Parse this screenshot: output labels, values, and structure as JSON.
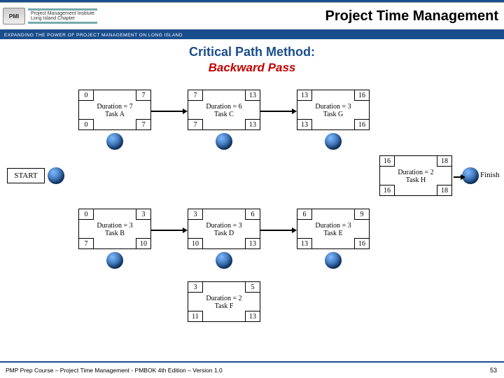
{
  "header": {
    "logo_badge": "PMI",
    "logo_line1": "Project Management Institute",
    "logo_line2": "Long Island Chapter",
    "tagline": "EXPANDING THE POWER OF PROJECT MANAGEMENT ON LONG ISLAND",
    "title": "Project Time Management"
  },
  "subtitle1": "Critical Path Method:",
  "subtitle2": "Backward Pass",
  "labels": {
    "start": "START",
    "finish": "Finish"
  },
  "chart_data": {
    "type": "diagram",
    "method": "CPM backward pass",
    "nodes": [
      {
        "id": "A",
        "name": "Task A",
        "duration": 7,
        "es": 0,
        "ef": 7,
        "ls": 0,
        "lf": 7
      },
      {
        "id": "B",
        "name": "Task B",
        "duration": 3,
        "es": 0,
        "ef": 3,
        "ls": 7,
        "lf": 10
      },
      {
        "id": "C",
        "name": "Task C",
        "duration": 6,
        "es": 7,
        "ef": 13,
        "ls": 7,
        "lf": 13
      },
      {
        "id": "D",
        "name": "Task D",
        "duration": 3,
        "es": 3,
        "ef": 6,
        "ls": 10,
        "lf": 13
      },
      {
        "id": "E",
        "name": "Task E",
        "duration": 3,
        "es": 6,
        "ef": 9,
        "ls": 13,
        "lf": 16
      },
      {
        "id": "F",
        "name": "Task F",
        "duration": 2,
        "es": 3,
        "ef": 5,
        "ls": 11,
        "lf": 13
      },
      {
        "id": "G",
        "name": "Task G",
        "duration": 3,
        "es": 13,
        "ef": 16,
        "ls": 13,
        "lf": 16
      },
      {
        "id": "H",
        "name": "Task H",
        "duration": 2,
        "es": 16,
        "ef": 18,
        "ls": 16,
        "lf": 18
      }
    ],
    "edges": [
      [
        "START",
        "A"
      ],
      [
        "START",
        "B"
      ],
      [
        "A",
        "C"
      ],
      [
        "C",
        "G"
      ],
      [
        "G",
        "H"
      ],
      [
        "H",
        "Finish"
      ],
      [
        "B",
        "D"
      ],
      [
        "D",
        "E"
      ],
      [
        "B",
        "F"
      ],
      [
        "D",
        "G"
      ],
      [
        "E",
        "H"
      ],
      [
        "F",
        "E"
      ]
    ]
  },
  "footer": "PMP Prep Course – Project Time Management - PMBOK 4th Edition – Version 1.0",
  "page": "53"
}
